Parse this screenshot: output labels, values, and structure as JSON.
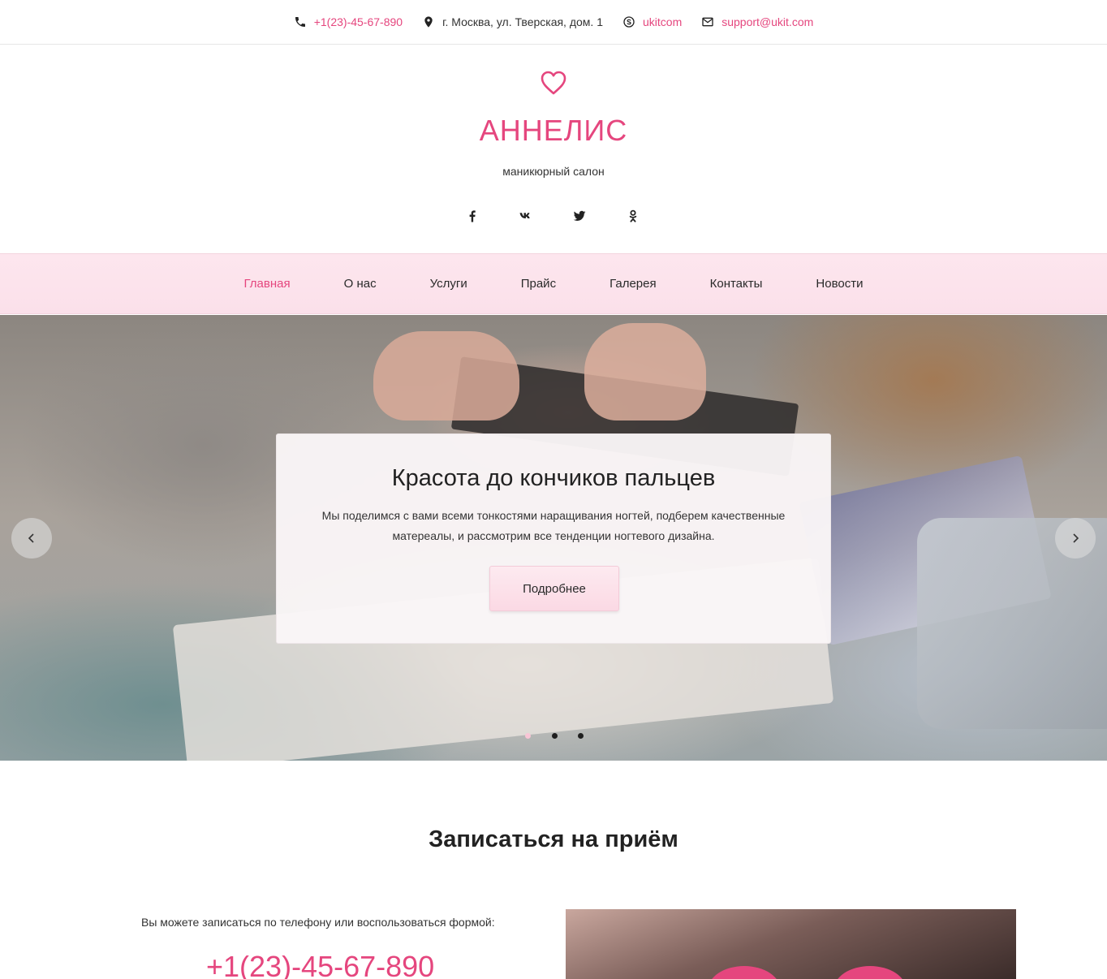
{
  "topbar": {
    "phone": "+1(23)-45-67-890",
    "address": "г. Москва, ул. Тверская, дом. 1",
    "skype": "ukitcom",
    "email": "support@ukit.com"
  },
  "brand": {
    "name": "АННЕЛИС",
    "tagline": "маникюрный салон",
    "accent_color": "#e5467e"
  },
  "socials": [
    "facebook-icon",
    "vk-icon",
    "twitter-icon",
    "odnoklassniki-icon"
  ],
  "nav": {
    "items": [
      {
        "label": "Главная",
        "active": true
      },
      {
        "label": "О нас"
      },
      {
        "label": "Услуги"
      },
      {
        "label": "Прайс"
      },
      {
        "label": "Галерея"
      },
      {
        "label": "Контакты"
      },
      {
        "label": "Новости"
      }
    ]
  },
  "hero": {
    "title": "Красота до кончиков пальцев",
    "text": "Мы поделимся с вами всеми тонкостями наращивания ногтей, подберем качественные матереалы, и рассмотрим все тенденции ногтевого дизайна.",
    "button": "Подробнее",
    "slide_count": 3,
    "active_slide": 1
  },
  "appointment": {
    "title": "Записаться на приём",
    "text": "Вы можете записаться по телефону или воспользоваться формой:",
    "phone": "+1(23)-45-67-890"
  }
}
